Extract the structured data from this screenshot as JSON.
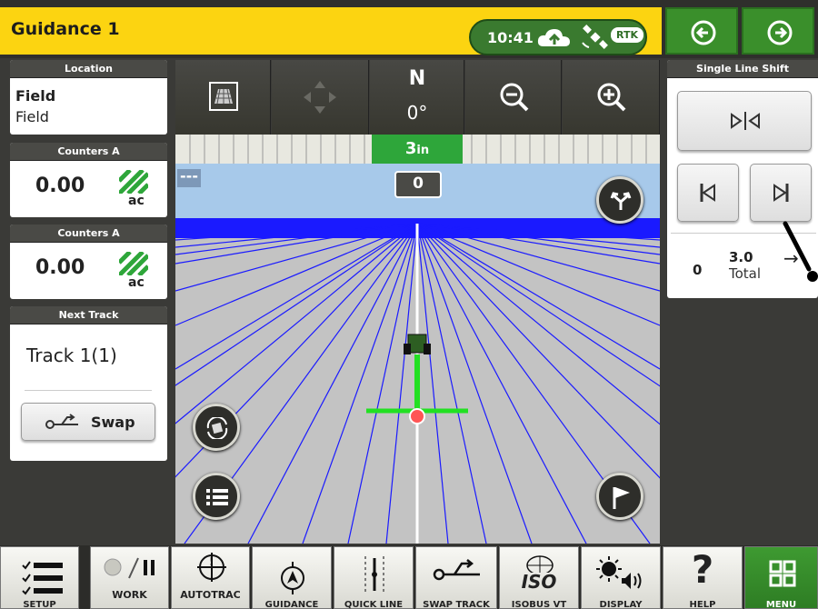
{
  "header": {
    "title": "Guidance 1",
    "time": "10:41",
    "rtk_badge": "RTK",
    "icons": [
      "cloud-upload-icon",
      "satellite-icon"
    ]
  },
  "nav": {
    "back_icon": "arrow-left-icon",
    "forward_icon": "arrow-right-icon"
  },
  "left": {
    "location": {
      "header": "Location",
      "line1": "Field",
      "line2": "Field"
    },
    "counters": [
      {
        "header": "Counters A",
        "value": "0.00",
        "unit": "ac"
      },
      {
        "header": "Counters A",
        "value": "0.00",
        "unit": "ac"
      }
    ],
    "next_track": {
      "header": "Next Track",
      "track": "Track 1(1)",
      "swap_label": "Swap"
    }
  },
  "map_toolbar": {
    "heading": "N",
    "heading_deg": "0°",
    "tools": [
      "map-view-icon",
      "pan-icon",
      "zoom-out-icon",
      "zoom-in-icon"
    ]
  },
  "lightbar": {
    "offset_value": "3",
    "offset_unit": "in"
  },
  "view": {
    "dash": "---",
    "cross_track": "0"
  },
  "shift_panel": {
    "header": "Single Line Shift",
    "current": "0",
    "shift_value": "3.0",
    "total_label": "Total",
    "arrow": "→"
  },
  "bottom_nav": {
    "setup": "SETUP",
    "work": "WORK",
    "autotrac": "AUTOTRAC",
    "guidance": "GUIDANCE",
    "quickline": "QUICK LINE",
    "swaptrack": "SWAP TRACK",
    "isobus": "ISOBUS VT",
    "display": "DISPLAY",
    "help": "HELP",
    "menu": "MENU",
    "isobus_glyph": "ISO",
    "help_glyph": "?"
  },
  "colors": {
    "title_yellow": "#fcd411",
    "jd_green": "#3a8f2b",
    "guidance_line": "#ffffff",
    "pass_lines": "#1a1aff"
  }
}
